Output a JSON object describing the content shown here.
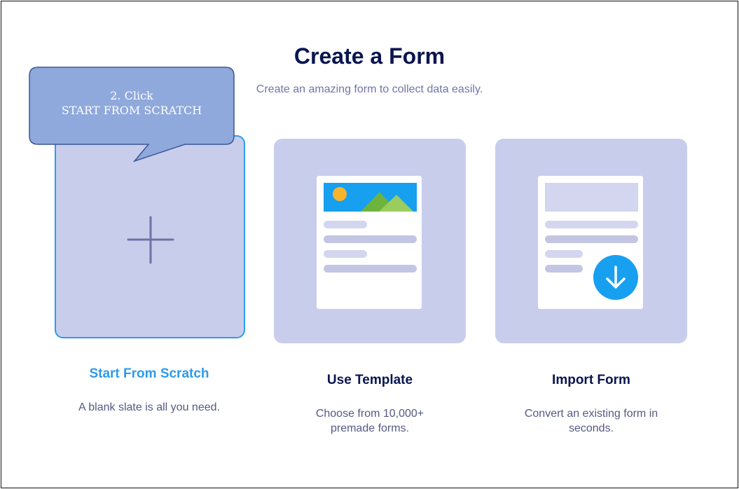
{
  "page": {
    "title": "Create a Form",
    "subtitle": "Create an amazing form to collect data easily."
  },
  "options": [
    {
      "title": "Start From Scratch",
      "desc_line1": "A blank slate is all you need.",
      "desc_line2": "",
      "icon": "plus-icon",
      "selected": true
    },
    {
      "title": "Use Template",
      "desc_line1": "Choose from 10,000+",
      "desc_line2": "premade forms.",
      "icon": "template-illustration-icon"
    },
    {
      "title": "Import Form",
      "desc_line1": "Convert an existing form in",
      "desc_line2": "seconds.",
      "icon": "import-download-icon"
    }
  ],
  "callout": {
    "line1": "2. Click",
    "line2": "START FROM SCRATCH"
  },
  "colors": {
    "title": "#0a1551",
    "accent_blue": "#2e9bea",
    "card_bg": "#c8cdec",
    "callout_fill": "#8fa9dc",
    "callout_border": "#3a5794"
  }
}
